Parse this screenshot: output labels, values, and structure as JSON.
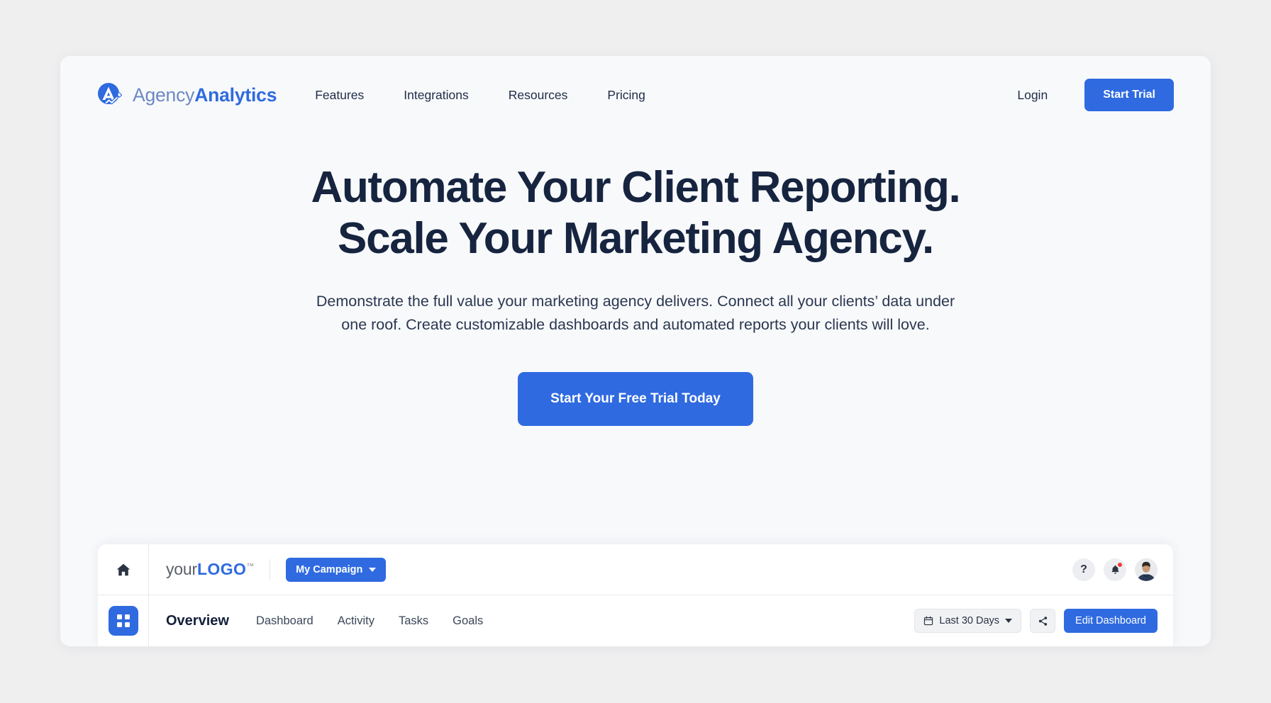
{
  "brand": {
    "logo_icon": "agency-analytics-logo-icon",
    "name_light": "Agency",
    "name_bold": "Analytics",
    "accent_color": "#2f6ae0",
    "text_dark": "#16243f"
  },
  "header": {
    "nav": [
      {
        "label": "Features"
      },
      {
        "label": "Integrations"
      },
      {
        "label": "Resources"
      },
      {
        "label": "Pricing"
      }
    ],
    "login_label": "Login",
    "trial_button_label": "Start Trial"
  },
  "hero": {
    "title_line_1": "Automate Your Client Reporting.",
    "title_line_2": "Scale Your Marketing Agency.",
    "sub_line_1": "Demonstrate the full value your marketing agency delivers. Connect all your clients’ data under",
    "sub_line_2": "one roof. Create customizable dashboards and automated reports your clients will love.",
    "cta_label": "Start Your Free Trial Today"
  },
  "dashboard_preview": {
    "home_icon": "home-icon",
    "grid_icon": "grid-apps-icon",
    "client_logo": {
      "prefix": "your",
      "bold": "LOGO",
      "trademark": "™"
    },
    "campaign_selector": {
      "label": "My Campaign",
      "caret_icon": "chevron-down-icon"
    },
    "help_icon_label": "?",
    "notification_icon": "bell-icon",
    "has_notification": true,
    "avatar_label": "user-avatar",
    "tabs": [
      {
        "label": "Overview",
        "active": true
      },
      {
        "label": "Dashboard",
        "active": false
      },
      {
        "label": "Activity",
        "active": false
      },
      {
        "label": "Tasks",
        "active": false
      },
      {
        "label": "Goals",
        "active": false
      }
    ],
    "date_range": {
      "label": "Last 30 Days",
      "calendar_icon": "calendar-icon",
      "caret_icon": "chevron-down-icon"
    },
    "share_icon": "share-icon",
    "edit_button_label": "Edit Dashboard"
  }
}
